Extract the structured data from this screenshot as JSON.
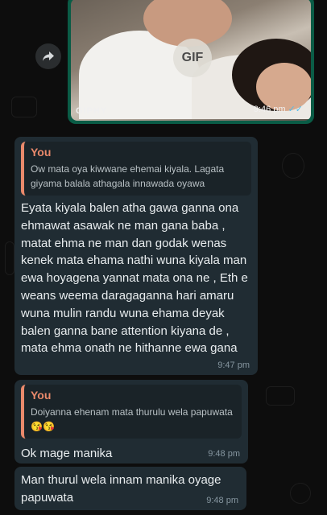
{
  "gif_message": {
    "badge": "GIF",
    "provider": "GIPHY",
    "time": "9:46 pm",
    "read_ticks": "✓✓"
  },
  "messages": [
    {
      "reply_to": {
        "name": "You",
        "text": "Ow mata oya kiwwane ehemai kiyala. Lagata giyama balala athagala innawada oyawa"
      },
      "text": "Eyata kiyala balen atha gawa ganna ona ehmawat asawak ne man gana baba , matat ehma ne man dan godak wenas kenek mata ehama nathi wuna kiyala man ewa hoyagena yannat mata  ona ne , Eth e weans weema daragaganna hari amaru wuna mulin randu wuna ehama deyak balen ganna bane attention kiyana de , mata ehma onath ne hithanne ewa gana",
      "time": "9:47 pm"
    },
    {
      "reply_to": {
        "name": "You",
        "text": "Doiyanna ehenam mata thurulu wela papuwata",
        "emoji": "😘😘"
      },
      "text": "Ok mage manika",
      "time": "9:48 pm"
    },
    {
      "text": "Man thurul wela innam manika oyage papuwata",
      "time": "9:48 pm"
    }
  ]
}
